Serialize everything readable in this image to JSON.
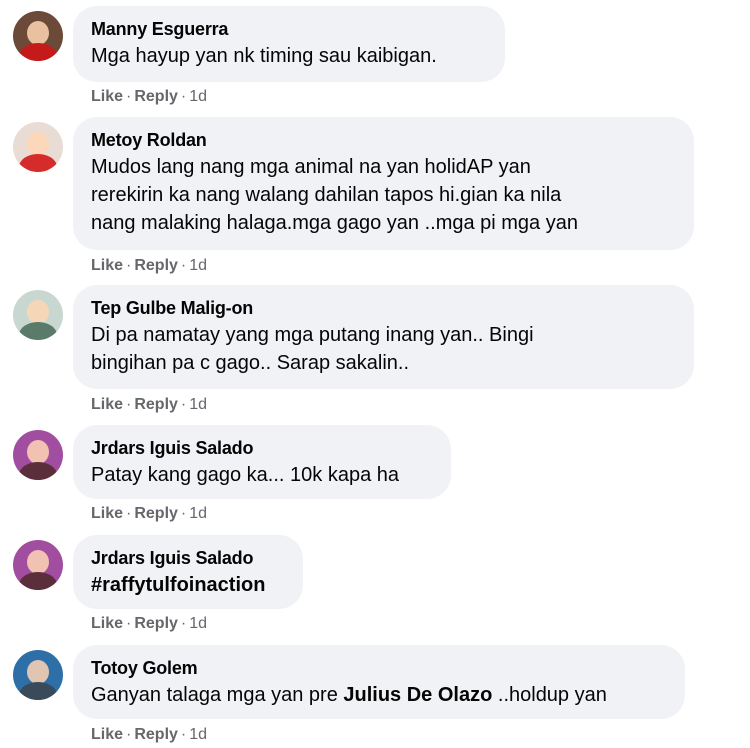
{
  "actions": {
    "like": "Like",
    "reply": "Reply",
    "separator": "·"
  },
  "comments": [
    {
      "author": "Manny Esguerra",
      "lines": [
        "Mga hayup yan nk timing sau kaibigan."
      ],
      "time": "1d",
      "avatar_colors": [
        "#6b4a3a",
        "#c41a1a"
      ]
    },
    {
      "author": "Metoy Roldan",
      "lines": [
        "Mudos lang nang mga animal na yan holidAP yan",
        "rerekirin ka nang walang dahilan tapos hi.gian ka nila",
        "nang malaking halaga.mga gago yan ..mga pi mga yan"
      ],
      "time": "1d",
      "avatar_colors": [
        "#e8dcd4",
        "#d62b2b"
      ]
    },
    {
      "author": "Tep Gulbe Malig-on",
      "lines": [
        "Di pa namatay yang mga putang inang yan.. Bingi",
        "bingihan pa c gago.. Sarap sakalin.."
      ],
      "time": "1d",
      "avatar_colors": [
        "#c8d8d0",
        "#5a7a6a"
      ]
    },
    {
      "author": "Jrdars Iguis Salado",
      "lines": [
        "Patay kang gago ka... 10k kapa ha"
      ],
      "time": "1d",
      "avatar_colors": [
        "#a14ea0",
        "#5a2e3a"
      ]
    },
    {
      "author": "Jrdars Iguis Salado",
      "lines": [
        "#raffytulfoinaction"
      ],
      "time": "1d",
      "avatar_colors": [
        "#a14ea0",
        "#5a2e3a"
      ]
    },
    {
      "author": "Totoy Golem",
      "line_prefix": "Ganyan talaga mga yan pre ",
      "mention": "Julius De Olazo",
      "line_suffix": " ..holdup yan",
      "time": "1d",
      "avatar_colors": [
        "#2f6fa8",
        "#3a4a5a"
      ]
    }
  ]
}
